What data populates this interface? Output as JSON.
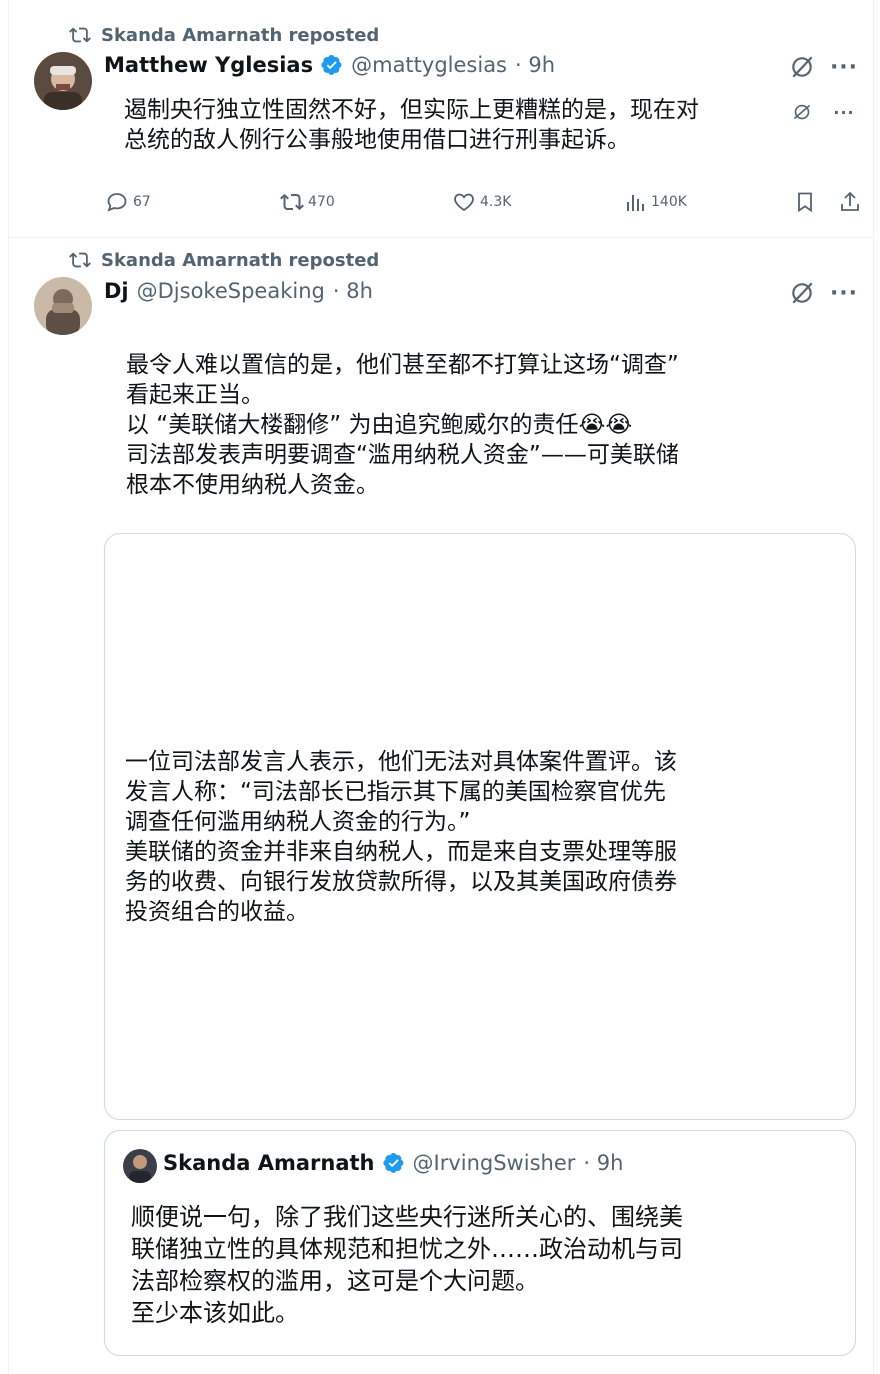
{
  "tweet1": {
    "repost_label": "Skanda Amarnath reposted",
    "author_name": "Matthew Yglesias",
    "author_handle": "@mattyglesias",
    "time": "· 9h",
    "text": "遏制央行独立性固然不好，但实际上更糟糕的是，现在对\n总统的敌人例行公事般地使用借口进行刑事起诉。",
    "replies": "67",
    "reposts": "470",
    "likes": "4.3K",
    "views": "140K"
  },
  "tweet2": {
    "repost_label": "Skanda Amarnath reposted",
    "author_name": "Dj",
    "author_handle": "@DjsokeSpeaking",
    "time": "· 8h",
    "text": "最令人难以置信的是，他们甚至都不打算让这场“调查”\n看起来正当。\n以 “美联储大楼翻修” 为由追究鲍威尔的责任😭😭\n司法部发表声明要调查“滥用纳税人资金”——可美联储\n根本不使用纳税人资金。",
    "image_text": "一位司法部发言人表示，他们无法对具体案件置评。该\n发言人称：“司法部长已指示其下属的美国检察官优先\n调查任何滥用纳税人资金的行为。”\n美联储的资金并非来自纳税人，而是来自支票处理等服\n务的收费、向银行发放贷款所得，以及其美国政府债券\n投资组合的收益。"
  },
  "quote": {
    "author_name": "Skanda Amarnath",
    "author_handle": "@IrvingSwisher",
    "time": "· 9h",
    "text": "顺便说一句，除了我们这些央行迷所关心的、围绕美\n联储独立性的具体规范和担忧之外……政治动机与司\n法部检察权的滥用，这可是个大问题。\n至少本该如此。"
  },
  "icons": {
    "repost": "repost-icon",
    "verified": "verified-badge-icon",
    "grok": "grok-icon",
    "more": "more-icon",
    "reply": "reply-icon",
    "like": "heart-icon",
    "views": "views-icon",
    "bookmark": "bookmark-icon",
    "share": "share-icon"
  },
  "colors": {
    "verified_blue": "#1d9bf0",
    "secondary_text": "#536471",
    "border": "#cfd9de"
  }
}
